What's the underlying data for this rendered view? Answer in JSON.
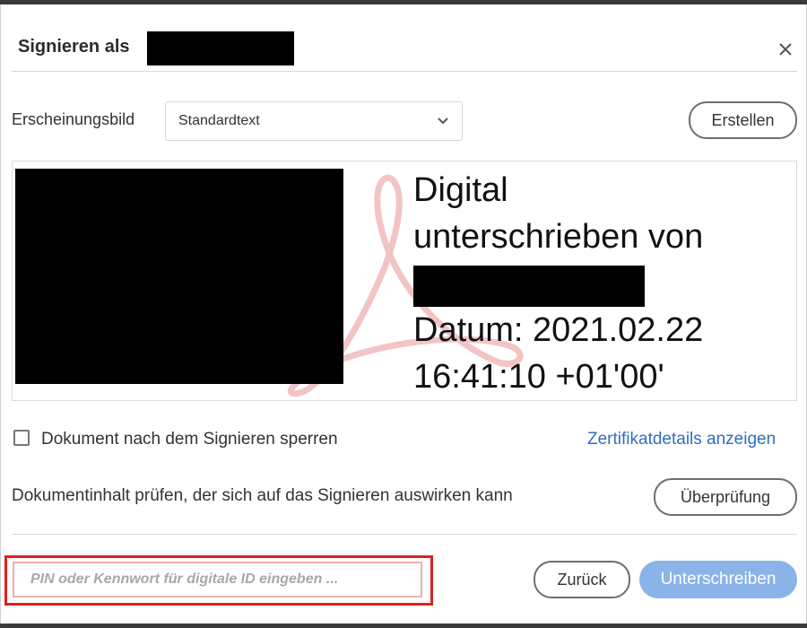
{
  "dialog": {
    "title": "Signieren als",
    "close_icon": "close-icon"
  },
  "appearance": {
    "label": "Erscheinungsbild",
    "selected": "Standardtext",
    "create_label": "Erstellen"
  },
  "preview": {
    "line1": "Digital",
    "line2": "unterschrieben von",
    "line3": "Datum: 2021.02.22",
    "line4": "16:41:10 +01'00'"
  },
  "options": {
    "lock_label": "Dokument nach dem Signieren sperren",
    "lock_checked": false,
    "cert_link": "Zertifikatdetails anzeigen"
  },
  "review": {
    "text": "Dokumentinhalt prüfen, der sich auf das Signieren auswirken kann",
    "button": "Überprüfung"
  },
  "footer": {
    "pin_placeholder": "PIN oder Kennwort für digitale ID eingeben ...",
    "back_label": "Zurück",
    "sign_label": "Unterschreiben"
  },
  "colors": {
    "highlight": "#e02020",
    "primary_button": "#8ab4e8",
    "link": "#2f6fbf",
    "watermark": "#f2c4c4"
  }
}
